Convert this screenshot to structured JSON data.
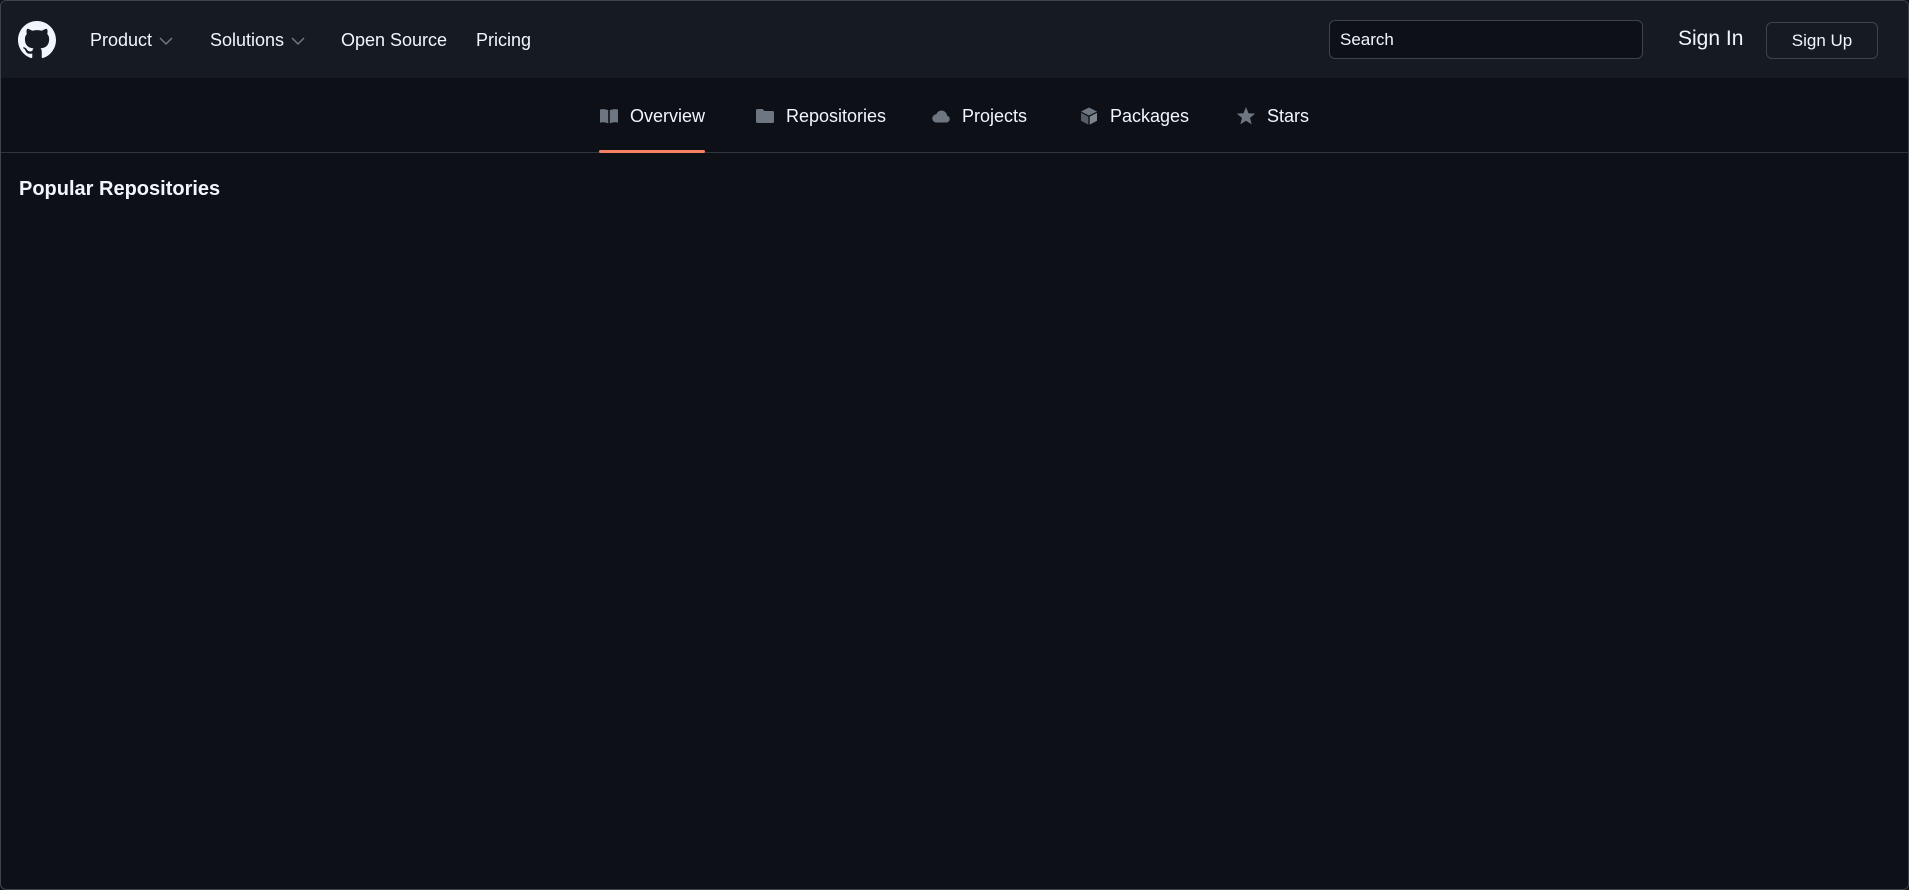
{
  "header": {
    "nav": {
      "product": "Product",
      "solutions": "Solutions",
      "open_source": "Open Source",
      "pricing": "Pricing"
    },
    "search": {
      "placeholder": "Search"
    },
    "sign_in": "Sign In",
    "sign_up": "Sign Up",
    "icons": {
      "logo": "github-mark-icon",
      "dropdown": "chevron-down-icon"
    }
  },
  "tabs": [
    {
      "label": "Overview",
      "icon": "book-icon",
      "active": true
    },
    {
      "label": "Repositories",
      "icon": "folder-icon",
      "active": false
    },
    {
      "label": "Projects",
      "icon": "cloud-icon",
      "active": false
    },
    {
      "label": "Packages",
      "icon": "package-icon",
      "active": false
    },
    {
      "label": "Stars",
      "icon": "star-icon",
      "active": false
    }
  ],
  "main": {
    "section_title": "Popular Repositories"
  },
  "colors": {
    "background": "#0d1117",
    "header_background": "#161b22",
    "border": "#3d444d",
    "text": "#f0f6fc",
    "icon_muted": "#6e7681",
    "active_tab_accent": "#f78166"
  }
}
